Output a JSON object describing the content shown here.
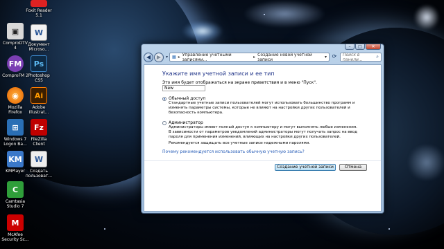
{
  "desktop": {
    "icons": [
      {
        "label": "Foxit Reader\n5.1",
        "icon": "foxit-reader-icon",
        "color": "#d22"
      },
      {
        "label": "ComproDTV\n4",
        "icon": "comprodtv-icon",
        "color": "#ccc"
      },
      {
        "label": "Документ\nMicroso...",
        "icon": "word-document-icon",
        "color": "#2b5797"
      },
      {
        "label": "ComproFM 2",
        "icon": "comprofm-icon",
        "color": "#7b3fb3"
      },
      {
        "label": "Photoshop\nCS5",
        "icon": "photoshop-icon",
        "color": "#1c5fa8"
      },
      {
        "label": "Mozilla\nFirefox",
        "icon": "firefox-icon",
        "color": "#e66000"
      },
      {
        "label": "Adobe\nIllustrat...",
        "icon": "illustrator-icon",
        "color": "#ff7c00"
      },
      {
        "label": "Windows 7\nLogon Ba...",
        "icon": "windows7-logon-icon",
        "color": "#2a6fb5"
      },
      {
        "label": "FileZilla\nClient",
        "icon": "filezilla-icon",
        "color": "#bf0000"
      },
      {
        "label": "KMPlayer",
        "icon": "kmplayer-icon",
        "color": "#3a78c9"
      },
      {
        "label": "Создать\nпользоват...",
        "icon": "create-user-icon",
        "color": "#eee"
      },
      {
        "label": "Camtasia\nStudio 7",
        "icon": "camtasia-icon",
        "color": "#2f9e3a"
      },
      {
        "label": "McAfee\nSecurity Sc...",
        "icon": "mcafee-icon",
        "color": "#c00"
      }
    ]
  },
  "window": {
    "breadcrumb": [
      "Управление учетными записями...",
      "Создание новой учетной записи"
    ],
    "search_placeholder": "Поиск в панели...",
    "title": "Укажите имя учетной записи и ее тип",
    "prompt": "Это имя будет отображаться на экране приветствия и в меню \"Пуск\".",
    "name_value": "New",
    "options": [
      {
        "label": "Обычный доступ",
        "selected": true,
        "description": "Стандартные учетные записи пользователей могут использовать большинство программ и изменять параметры системы, которые не влияют на настройки других пользователей и безопасность компьютера."
      },
      {
        "label": "Администратор",
        "selected": false,
        "description": "Администраторы имеют полный доступ к компьютеру и могут выполнять любые изменения. В зависимости от параметров уведомлений администраторы могут получать запрос на ввод пароля для применения изменений, влияющих на настройки других пользователей."
      }
    ],
    "note": "Рекомендуется защищать все учетные записи надежными паролями.",
    "help_link": "Почему рекомендуется использовать обычную учетную запись?",
    "create_button": "Создание учетной записи",
    "cancel_button": "Отмена"
  }
}
